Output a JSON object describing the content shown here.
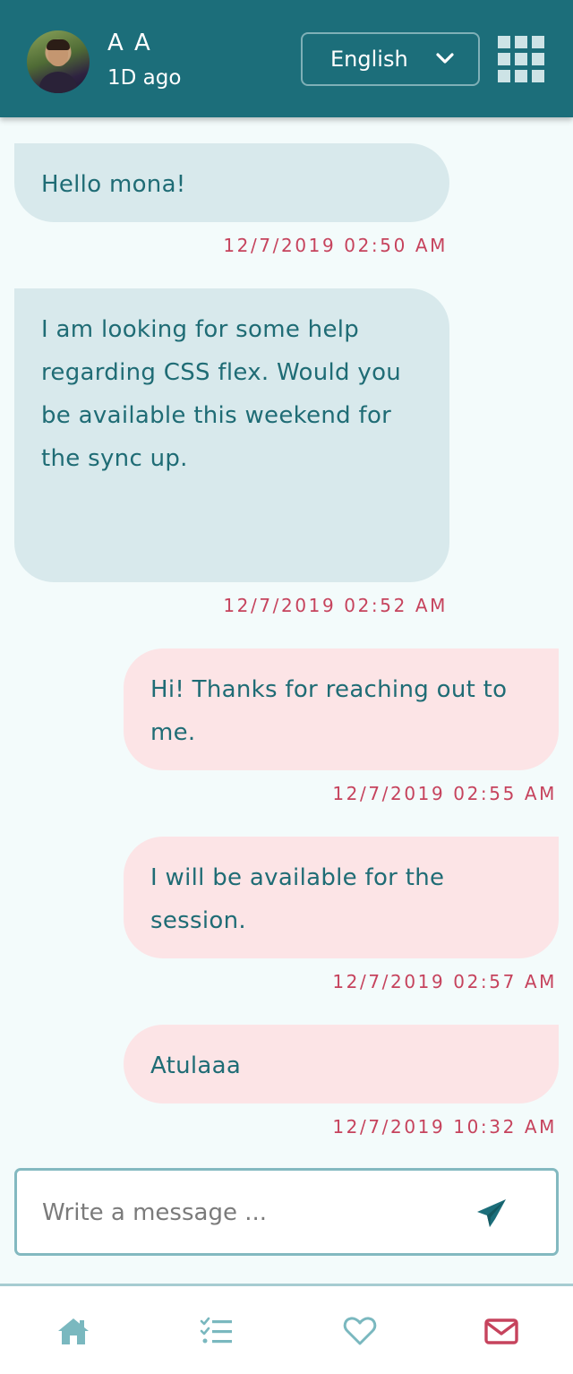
{
  "header": {
    "user_name": "A A",
    "status": "1D ago",
    "language": "English",
    "icons": {
      "menu": "grid-icon",
      "language_toggle": "chevron-down-icon"
    }
  },
  "messages": [
    {
      "text": "Hello mona!",
      "time": "12/7/2019 02:50 AM",
      "direction": "incoming"
    },
    {
      "text": "I am looking for some help regarding CSS flex. Would you be available this weekend for the sync up.",
      "time": "12/7/2019 02:52 AM",
      "direction": "incoming"
    },
    {
      "text": "Hi! Thanks for reaching out to me.",
      "time": "12/7/2019 02:55 AM",
      "direction": "outgoing"
    },
    {
      "text": "I will be available for the session.",
      "time": "12/7/2019 02:57 AM",
      "direction": "outgoing"
    },
    {
      "text": "Atulaaa",
      "time": "12/7/2019 10:32 AM",
      "direction": "outgoing"
    }
  ],
  "composer": {
    "placeholder": "Write a message ...",
    "value": "",
    "send_icon": "paper-plane-icon"
  },
  "nav": {
    "items": [
      {
        "icon": "home-icon",
        "active": false
      },
      {
        "icon": "checklist-icon",
        "active": false
      },
      {
        "icon": "heart-icon",
        "active": false
      },
      {
        "icon": "envelope-icon",
        "active": true
      }
    ]
  },
  "colors": {
    "header_bg": "#1c6e7a",
    "page_bg": "#f3fbfb",
    "incoming_bubble": "#d8e9ec",
    "outgoing_bubble": "#fce4e6",
    "text": "#1f6c75",
    "timestamp": "#c6435d",
    "nav_inactive": "#7ab8bf",
    "nav_active": "#c6435d"
  }
}
